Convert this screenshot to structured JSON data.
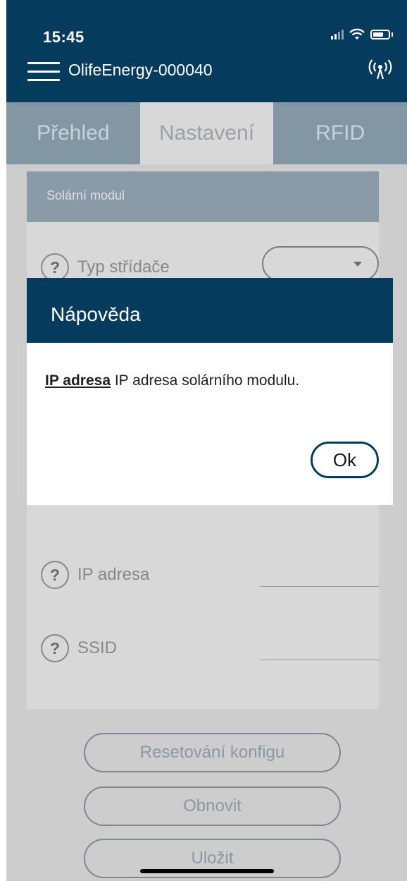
{
  "status_bar": {
    "time": "15:45"
  },
  "header": {
    "title": "OlifeEnergy-000040",
    "menu_icon": "hamburger-menu-icon",
    "connection_icon": "antenna-icon"
  },
  "tabs": [
    {
      "label": "Přehled",
      "active": false
    },
    {
      "label": "Nastavení",
      "active": true
    },
    {
      "label": "RFID",
      "active": false
    }
  ],
  "section": {
    "title": "Solární modul",
    "rows": [
      {
        "label": "Typ střídače",
        "kind": "select",
        "value": ""
      },
      {
        "label": "IP adresa",
        "kind": "text",
        "value": ""
      },
      {
        "label": "SSID",
        "kind": "text",
        "value": ""
      }
    ]
  },
  "buttons": {
    "reset": "Resetování konfigu",
    "refresh": "Obnovit",
    "save": "Uložit"
  },
  "dialog": {
    "title": "Nápověda",
    "keyword": "IP adresa",
    "text": " IP adresa solárního modulu.",
    "ok": "Ok"
  },
  "colors": {
    "brand_dark": "#053c5e",
    "tab_bar": "#8396a3",
    "overlay_bg": "#cdcdcd"
  }
}
